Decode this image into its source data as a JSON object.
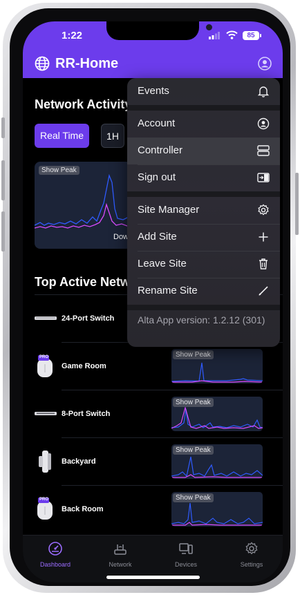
{
  "status_bar": {
    "time": "1:22",
    "battery": "85"
  },
  "header": {
    "title": "RR-Home"
  },
  "network_activity": {
    "title": "Network Activity",
    "time_buttons": [
      "Real Time",
      "1H"
    ],
    "show_peak_label": "Show Peak",
    "legend_partial": "Dow"
  },
  "top_active": {
    "title": "Top Active Netwo",
    "devices": [
      {
        "name": "24-Port Switch",
        "icon": "switch-icon"
      },
      {
        "name": "Game Room",
        "icon": "access-point-pro-icon",
        "badge": "PRO",
        "show_peak": "Show Peak"
      },
      {
        "name": "8-Port Switch",
        "icon": "switch-icon",
        "show_peak": "Show Peak"
      },
      {
        "name": "Backyard",
        "icon": "outdoor-ap-icon",
        "show_peak": "Show Peak"
      },
      {
        "name": "Back Room",
        "icon": "access-point-pro-icon",
        "badge": "PRO",
        "show_peak": "Show Peak"
      }
    ]
  },
  "menu": {
    "items": [
      {
        "label": "Events",
        "icon": "bell-icon"
      },
      {
        "label": "Account",
        "icon": "user-circle-icon"
      },
      {
        "label": "Controller",
        "icon": "controller-icon"
      },
      {
        "label": "Sign out",
        "icon": "sign-out-icon"
      },
      {
        "label": "Site Manager",
        "icon": "gear-icon"
      },
      {
        "label": "Add Site",
        "icon": "plus-icon"
      },
      {
        "label": "Leave Site",
        "icon": "trash-icon"
      },
      {
        "label": "Rename Site",
        "icon": "pencil-icon"
      }
    ],
    "version": "Alta App version: 1.2.12 (301)"
  },
  "tabs": [
    {
      "label": "Dashboard",
      "icon": "dashboard-icon",
      "active": true
    },
    {
      "label": "Network",
      "icon": "network-icon"
    },
    {
      "label": "Devices",
      "icon": "devices-icon"
    },
    {
      "label": "Settings",
      "icon": "settings-icon"
    }
  ],
  "colors": {
    "accent": "#6c3cec",
    "download": "#2f5bff",
    "upload": "#d94bff",
    "chart_bg": "#1c2438"
  }
}
